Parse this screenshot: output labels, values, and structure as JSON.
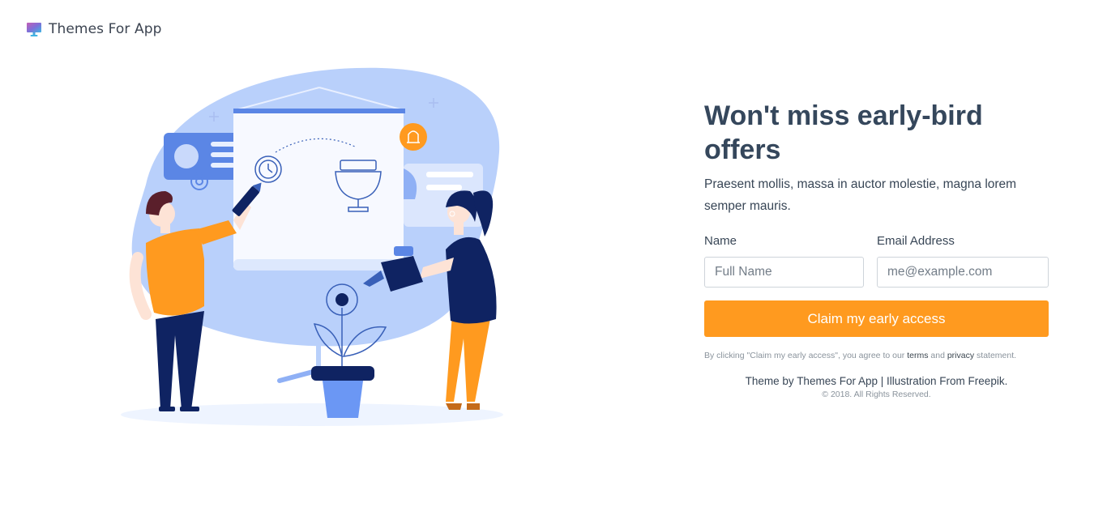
{
  "brand": {
    "name": "Themes For App"
  },
  "hero": {
    "title": "Won't miss early-bird offers",
    "description": "Praesent mollis, massa in auctor molestie, magna lorem semper mauris."
  },
  "form": {
    "name_label": "Name",
    "name_placeholder": "Full Name",
    "name_value": "",
    "email_label": "Email Address",
    "email_placeholder": "me@example.com",
    "email_value": "",
    "submit_label": "Claim my early access"
  },
  "terms": {
    "prefix": "By clicking \"Claim my early access\", you agree to our",
    "terms_link": "terms",
    "and": "and",
    "privacy_link": "privacy",
    "suffix": "statement."
  },
  "credits": {
    "theme_by": "Theme by Themes For App",
    "separator": "|",
    "illustration": "Illustration From Freepik.",
    "copyright": "© 2018. All Rights Reserved."
  },
  "colors": {
    "accent": "#ff9a1f",
    "heading": "#35475c",
    "illustration_blob": "#b9d0fb",
    "illustration_navy": "#0f2362"
  },
  "icons": {
    "logo": "monitor-icon",
    "illustration": "team-growth-illustration"
  }
}
